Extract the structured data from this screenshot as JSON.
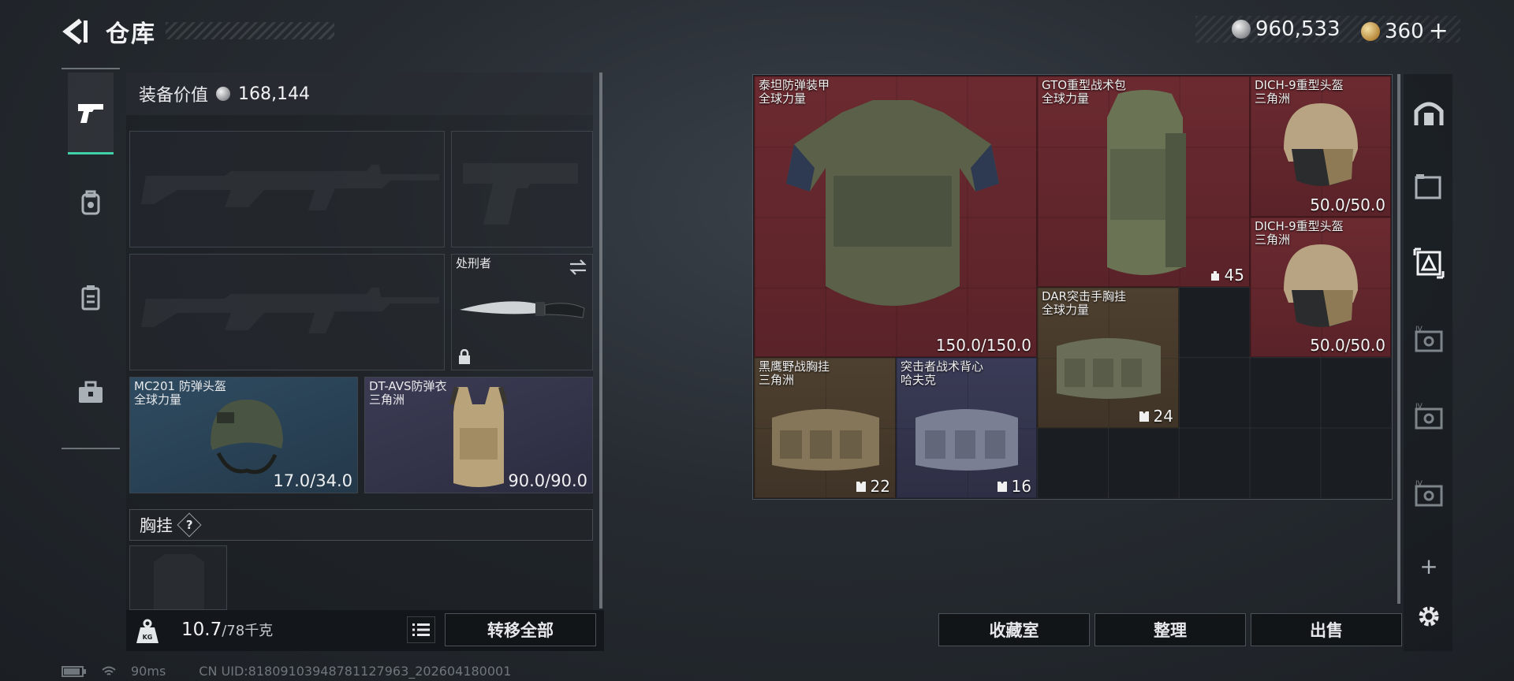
{
  "header": {
    "title": "仓库",
    "currencies": [
      {
        "icon": "silver-coin-icon",
        "value": "960,533"
      },
      {
        "icon": "gold-coin-icon",
        "value": "360"
      }
    ],
    "add_symbol": "+"
  },
  "loadout": {
    "equip_value_label": "装备价值",
    "equip_value": "168,144",
    "tabs": [
      "gun-icon",
      "backpack-icon",
      "clipboard-icon",
      "briefcase-icon"
    ],
    "melee": {
      "name": "处刑者"
    },
    "helmet": {
      "name": "MC201 防弹头盔",
      "map": "全球力量",
      "durability": "17.0/34.0"
    },
    "armor": {
      "name": "DT-AVS防弹衣",
      "map": "三角洲",
      "durability": "90.0/90.0"
    },
    "rig_header": "胸挂",
    "rig_help": "?"
  },
  "bottom": {
    "weight": "10.7",
    "weight_max": "/78千克",
    "weight_icon_text": "KG",
    "transfer_all": "转移全部"
  },
  "status": {
    "ping": "90ms",
    "uid": "CN UID:8180910394878112796​3_202604180001"
  },
  "stash": {
    "items": [
      {
        "key": "titan",
        "name": "泰坦防弹装甲",
        "map": "全球力量",
        "value": "150.0/150.0",
        "rarity": "red"
      },
      {
        "key": "gto",
        "name": "GTO重型战术包",
        "map": "全球力量",
        "value": "45",
        "rarity": "red"
      },
      {
        "key": "dich1",
        "name": "DICH-9重型头盔",
        "map": "三角洲",
        "value": "50.0/50.0",
        "rarity": "red"
      },
      {
        "key": "dich2",
        "name": "DICH-9重型头盔",
        "map": "三角洲",
        "value": "50.0/50.0",
        "rarity": "red"
      },
      {
        "key": "dar",
        "name": "DAR突击手胸挂",
        "map": "全球力量",
        "value": "24",
        "rarity": "gold"
      },
      {
        "key": "hawk",
        "name": "黑鹰野战胸挂",
        "map": "三角洲",
        "value": "22",
        "rarity": "gold"
      },
      {
        "key": "assault",
        "name": "突击者战术背心",
        "map": "哈夫克",
        "value": "16",
        "rarity": "violet"
      }
    ],
    "buttons": {
      "collection": "收藏室",
      "organize": "整理",
      "sell": "出售"
    }
  },
  "right_rail": {
    "add": "+"
  },
  "colors": {
    "accent": "#3fd2a8",
    "red_rarity": "#6b2a30",
    "gold_rarity": "#4e4030",
    "violet_rarity": "#3a3b56",
    "blue_rarity": "#2f4b61"
  }
}
